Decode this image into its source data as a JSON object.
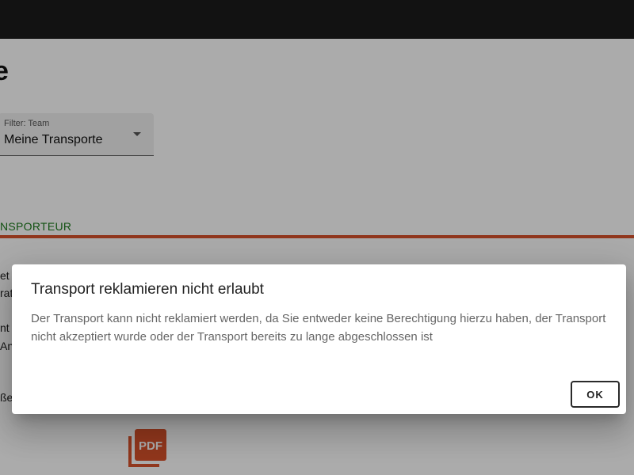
{
  "page": {
    "title": "e",
    "filter": {
      "label": "Filter: Team",
      "value": "Meine Transporte"
    },
    "tab": {
      "label": "NSPORTEUR"
    },
    "fragments": [
      "et",
      "rat",
      "nt",
      "Ant",
      "ße"
    ],
    "pdf_icon": {
      "text": "PDF",
      "color": "#d9532c"
    }
  },
  "dialog": {
    "title": "Transport reklamieren nicht erlaubt",
    "message": "Der Transport kann nicht reklamiert werden, da Sie entweder keine Berechtigung hierzu haben, der Transport nicht akzeptiert wurde oder der Transport bereits zu lange abgeschlossen ist",
    "ok_label": "OK"
  }
}
